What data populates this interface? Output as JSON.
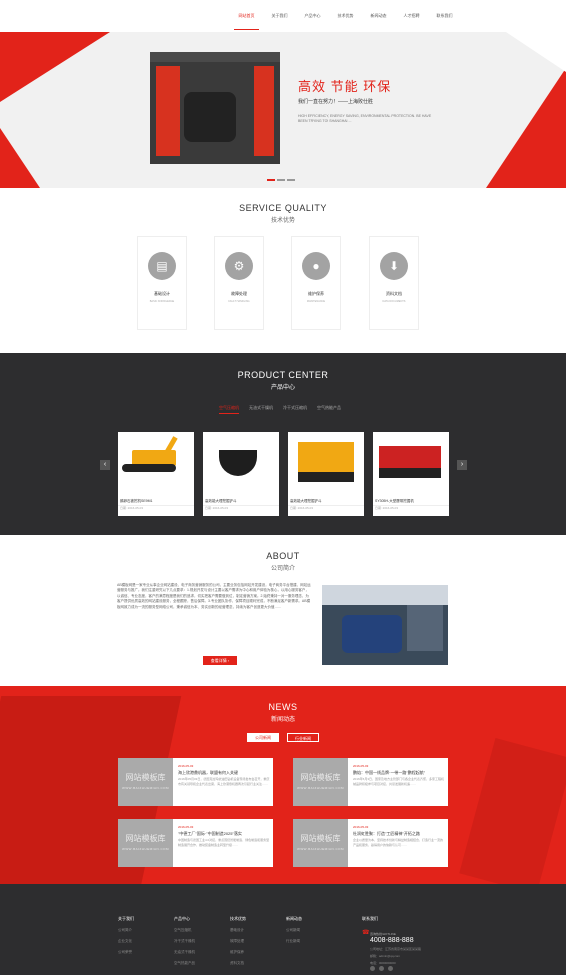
{
  "nav": {
    "items": [
      "网站首页",
      "关于我们",
      "产品中心",
      "技术优势",
      "新闻动态",
      "人才招聘",
      "联系我们"
    ],
    "active": 0
  },
  "hero": {
    "title": "高效 节能 环保",
    "subtitle": "我们一直在努力！——上海败仕胜",
    "description": "HIGH EFFICIENCY, ENERGY SAVING, ENVIRONMENTAL PROTECTION. BE HAVE BEEN TRYING TO! SHANGHAI ..."
  },
  "service": {
    "title": "SERVICE QUALITY",
    "subtitle": "技术优势",
    "items": [
      {
        "icon": "document-icon",
        "label": "基础设计",
        "english": "BASIC KNOWLEDGE"
      },
      {
        "icon": "gear-icon",
        "label": "故障处理",
        "english": "FAULT HANDLING"
      },
      {
        "icon": "user-icon",
        "label": "维护保养",
        "english": "MAINTENANCE"
      },
      {
        "icon": "download-icon",
        "label": "资料文档",
        "english": "DATA DOCUMENTS"
      }
    ]
  },
  "products": {
    "title": "PRODUCT CENTER",
    "subtitle": "产品中心",
    "tabs": [
      "空气压缩机",
      "无油式干燥机",
      "冷干式压缩机",
      "空气热能产品"
    ],
    "active_tab": 0,
    "prev": "‹",
    "next": "›",
    "items": [
      {
        "name": "鹅卵石被挖机SE9M1",
        "date": "日期: 2016-05-03"
      },
      {
        "name": "高效能大理挖掘铲斗",
        "date": "日期: 2016-05-03"
      },
      {
        "name": "高效能大理挖掘铲斗",
        "date": "日期: 2016-05-03"
      },
      {
        "name": "SY305H-大型履带挖掘机",
        "date": "日期: 2016-05-03"
      }
    ]
  },
  "about": {
    "title": "ABOUT",
    "subtitle": "公司简介",
    "text": "AB模板网是一家专业从事企业网站建设、电子商务营销服务的公司，主要业务包括网站开发建设，电子商务平台搭建、网站运营服务与推广。我们注重研究以下几点要求：1.规划开发与设计主要以客户需求为中心和用户体验为核心，以用心服务客户，以诚信、专业态度，客户的满意程度是我们的追求，切实把客户需要做到位，制定营销方案。2.始终秉持一对一服务理念，为客户提供优质高效的网站建设服务，全程跟踪，售后保障。3.专业团队协作，保障项目顺利完成，不断满足客户新需求。AB模板网致力成为一流的服务型网络公司，秉承诚信为本、务实创新的经营理念，持续为客户创造更大价值……",
    "more": "查看详情 ›"
  },
  "news": {
    "title": "NEWS",
    "subtitle": "新闻动态",
    "tabs": [
      "公司新闻",
      "行业新闻"
    ],
    "thumb_text": "网站模板库",
    "thumb_url": "WWW.BAIZHUEMIAN.COM",
    "items": [
      {
        "date": "2016-05-03",
        "title": "海上欣港鼎机器，联盟有何入关键",
        "excerpt": "2016年05月03日，德国克拉玛依油田钻机设备现场发布会召开，重庆市有关领导和企业代表出席，海上欣港鼎机器再次引起行业关注……"
      },
      {
        "date": "2016-05-03",
        "title": "鹏焰：中国一线品牌·一带一路\"鹏程起航\"",
        "excerpt": "2016年5月3日，国家及地方主管部门与各企业代表齐聚，多家工程机械品牌积极参与项目对接，共谋发展新机遇……"
      },
      {
        "date": "2016-05-03",
        "title": "\"中德工厂\"国际·\"中国制造2025\"落实",
        "excerpt": "中国制造与德国工业4.0对接，重点围绕智能制造、绿色制造和服务型制造展开合作，推动装备制造业转型升级……"
      },
      {
        "date": "2016-05-03",
        "title": "杜润虹胜聚：打造\"工匠精神\"开拓之路",
        "excerpt": "企业以质量为本，坚持技术创新与精益制造相结合，打造行业一流的产品和服务，赢得用户的信赖与认可……"
      }
    ]
  },
  "footer": {
    "columns": [
      {
        "heading": "关于我们",
        "items": [
          "公司简介",
          "企业文化",
          "公司荣誉"
        ]
      },
      {
        "heading": "产品中心",
        "items": [
          "空气压缩机",
          "冷干式干燥机",
          "无油式干燥机",
          "空气热能产品"
        ]
      },
      {
        "heading": "技术优势",
        "items": [
          "基础设计",
          "故障处理",
          "维护保养",
          "资料文档"
        ]
      },
      {
        "heading": "新闻动态",
        "items": [
          "公司新闻",
          "行业新闻"
        ]
      }
    ],
    "contact": {
      "heading": "联系我们",
      "phone_label": "咨询热线/HOTLINE",
      "phone": "4008-888-888",
      "lines": [
        "公司地址：江苏省南京市某某区某某路",
        "邮箱：admin@qq.com",
        "电话：0000000000"
      ]
    }
  }
}
